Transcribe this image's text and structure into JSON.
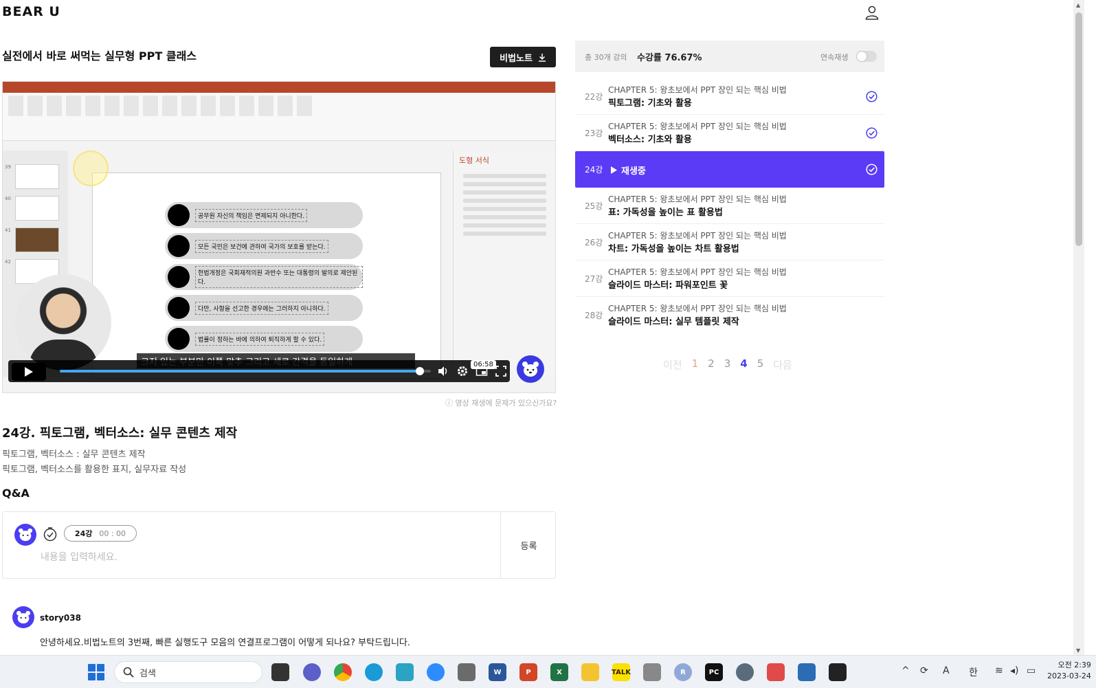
{
  "header": {
    "logo": "BEAR U",
    "user_icon": "user-icon"
  },
  "course": {
    "title": "실전에서 바로 써먹는 실무형 PPT 클래스",
    "note_button": "비법노트"
  },
  "video": {
    "subtitle": "크지 있는 부분만 이쪽 맞추 그리고 세로 간격을 동일하게",
    "time_tooltip": "06:58",
    "progress": 0.97,
    "slide_lines": [
      "공무원 자신의 책임은 면제되지 아니한다.",
      "모든 국민은 보건에 관하여 국가의 보호를 받는다.",
      "헌법개정은 국회재적의원 과반수 또는 대통령의 발의로 제안된다.",
      "다만, 사형을 선고한 경우에는 그러하지 아니하다.",
      "법률이 정하는 바에 의하여 퇴직하게 할 수 있다."
    ],
    "format_pane_title": "도형 서식",
    "help_text": "영상 재생에 문제가 있으신가요?"
  },
  "lecture": {
    "title": "24강. 픽토그램, 벡터소스: 실무 콘텐츠 제작",
    "desc1": "픽토그램, 벡터소스 : 실무 콘텐츠 제작",
    "desc2": "픽토그램, 벡터소스를 활용한 표지, 실무자료 작성"
  },
  "qa": {
    "title": "Q&A",
    "chip_lecture": "24강",
    "chip_time": "00 : 00",
    "placeholder": "내용을 입력하세요.",
    "submit": "등록"
  },
  "comment": {
    "user": "story038",
    "text": "안녕하세요.비법노트의 3번째, 빠른 실행도구 모음의 연결프로그램이 어떻게 되나요? 부탁드립니다."
  },
  "panel": {
    "count": "총 30개 강의",
    "progress": "수강률 76.67%",
    "autoplay": "연속재생",
    "autoplay_on": false,
    "items": [
      {
        "num": "22강",
        "chapter": "CHAPTER 5: 왕초보에서 PPT 장인 되는 핵심 비법",
        "name": "픽토그램: 기초와 활용",
        "done": true
      },
      {
        "num": "23강",
        "chapter": "CHAPTER 5: 왕초보에서 PPT 장인 되는 핵심 비법",
        "name": "벡터소스: 기초와 활용",
        "done": true
      },
      {
        "num": "24강",
        "playing": "재생중",
        "done": true
      },
      {
        "num": "25강",
        "chapter": "CHAPTER 5: 왕초보에서 PPT 장인 되는 핵심 비법",
        "name": "표: 가독성을 높이는 표 활용법",
        "done": false
      },
      {
        "num": "26강",
        "chapter": "CHAPTER 5: 왕초보에서 PPT 장인 되는 핵심 비법",
        "name": "차트: 가독성을 높이는 차트 활용법",
        "done": false
      },
      {
        "num": "27강",
        "chapter": "CHAPTER 5: 왕초보에서 PPT 장인 되는 핵심 비법",
        "name": "슬라이드 마스터: 파워포인트 꽃",
        "done": false
      },
      {
        "num": "28강",
        "chapter": "CHAPTER 5: 왕초보에서 PPT 장인 되는 핵심 비법",
        "name": "슬라이드 마스터: 실무 템플릿 제작",
        "done": false
      }
    ],
    "pager": {
      "prev": "이전",
      "pages": [
        "1",
        "2",
        "3",
        "4",
        "5"
      ],
      "current": "4",
      "next": "다음"
    }
  },
  "taskbar": {
    "search": "검색",
    "time": "오전 2:39",
    "date": "2023-03-24",
    "tray_lang": "A",
    "tray_ime": "한"
  },
  "colors": {
    "accent": "#5b3bf5",
    "dark_button": "#1f1f1f",
    "ppt_red": "#b7472a"
  }
}
